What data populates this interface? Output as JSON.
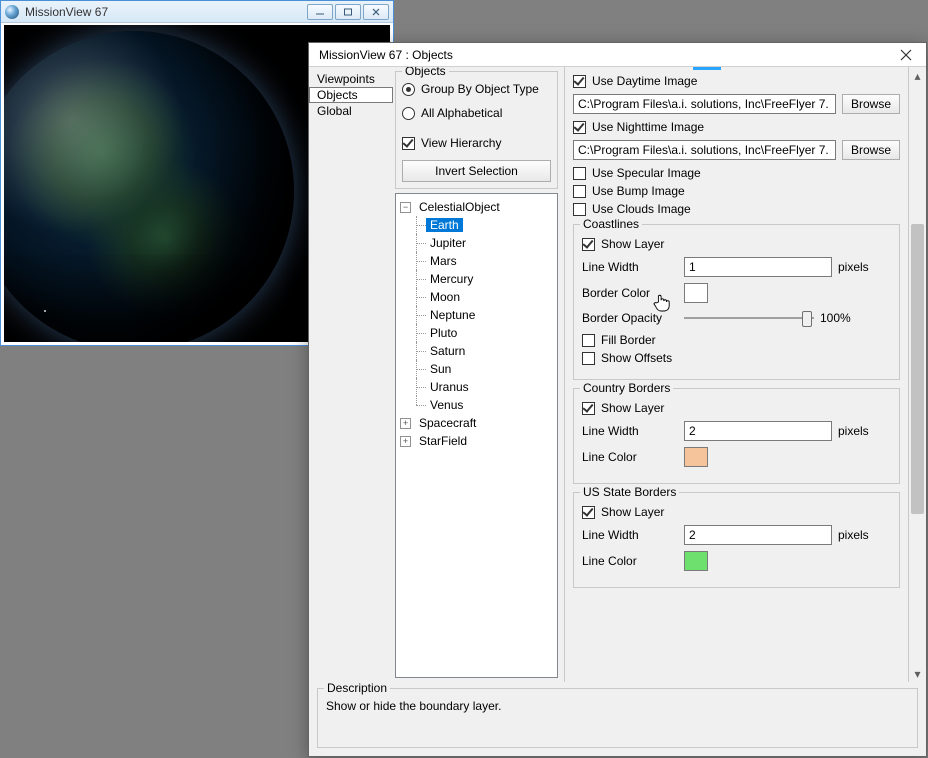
{
  "bg_window": {
    "title": "MissionView 67"
  },
  "dialog": {
    "title": "MissionView 67 : Objects",
    "nav": [
      "Viewpoints",
      "Objects",
      "Global"
    ],
    "nav_selected": 1,
    "objects_group": {
      "legend": "Objects",
      "radio_group_by": "Group By Object Type",
      "radio_alpha": "All Alphabetical",
      "radio_selected": 0,
      "view_hierarchy": {
        "label": "View Hierarchy",
        "checked": true
      },
      "invert_btn": "Invert Selection"
    },
    "tree": {
      "root": "CelestialObject",
      "root_expanded": true,
      "children": [
        "Earth",
        "Jupiter",
        "Mars",
        "Mercury",
        "Moon",
        "Neptune",
        "Pluto",
        "Saturn",
        "Sun",
        "Uranus",
        "Venus"
      ],
      "selected_child": 0,
      "siblings": [
        "Spacecraft",
        "StarField"
      ],
      "siblings_expanded": false
    },
    "props": {
      "use_daytime": {
        "label": "Use Daytime Image",
        "checked": true
      },
      "path_daytime": "C:\\Program Files\\a.i. solutions, Inc\\FreeFlyer 7.",
      "use_nighttime": {
        "label": "Use Nighttime Image",
        "checked": true
      },
      "path_nighttime": "C:\\Program Files\\a.i. solutions, Inc\\FreeFlyer 7.",
      "use_specular": {
        "label": "Use Specular Image",
        "checked": false
      },
      "use_bump": {
        "label": "Use Bump Image",
        "checked": false
      },
      "use_clouds": {
        "label": "Use Clouds Image",
        "checked": false
      },
      "browse_label": "Browse",
      "pixels_label": "pixels",
      "coastlines": {
        "legend": "Coastlines",
        "show_layer": {
          "label": "Show Layer",
          "checked": true
        },
        "line_width_label": "Line Width",
        "line_width": "1",
        "border_color_label": "Border Color",
        "border_color": "#ffffff",
        "border_opacity_label": "Border Opacity",
        "border_opacity_pct": "100%",
        "fill_border": {
          "label": "Fill Border",
          "checked": false
        },
        "show_offsets": {
          "label": "Show Offsets",
          "checked": false
        }
      },
      "country": {
        "legend": "Country Borders",
        "show_layer": {
          "label": "Show Layer",
          "checked": true
        },
        "line_width_label": "Line Width",
        "line_width": "2",
        "line_color_label": "Line Color",
        "line_color": "#f5c49a"
      },
      "us_states": {
        "legend": "US State Borders",
        "show_layer": {
          "label": "Show Layer",
          "checked": true
        },
        "line_width_label": "Line Width",
        "line_width": "2",
        "line_color_label": "Line Color",
        "line_color": "#6ee06e"
      }
    },
    "description": {
      "legend": "Description",
      "text": "Show or hide the boundary layer."
    }
  }
}
